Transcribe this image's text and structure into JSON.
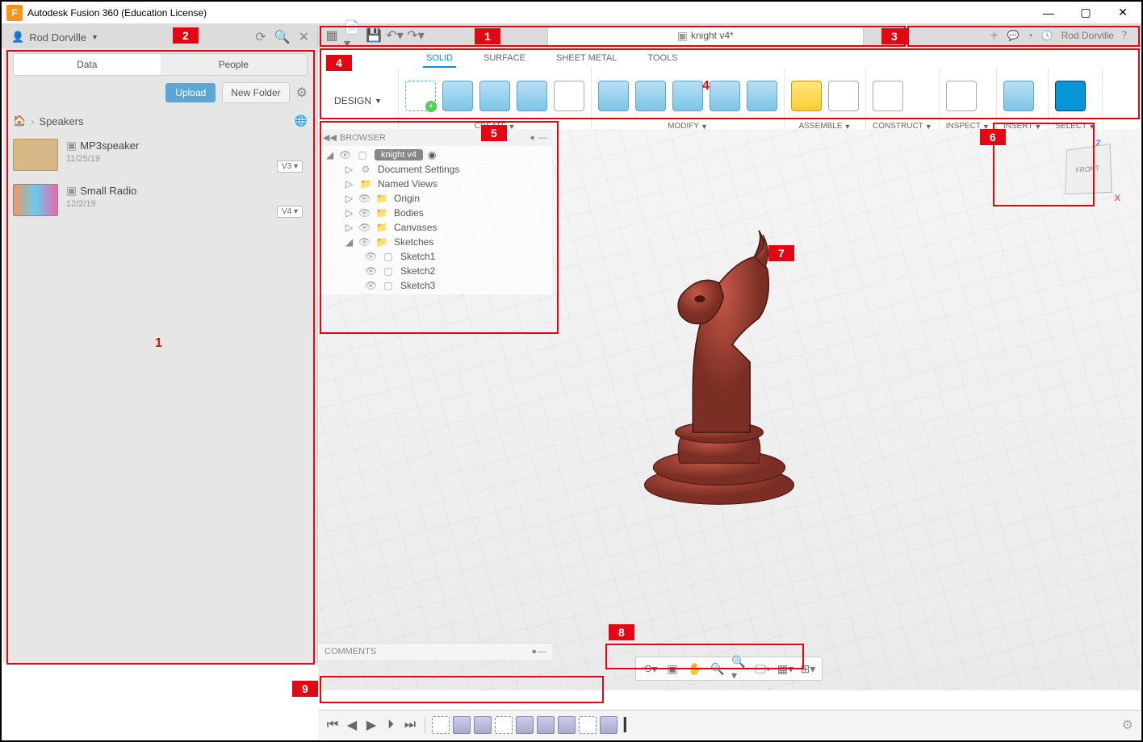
{
  "titlebar": {
    "app_title": "Autodesk Fusion 360 (Education License)"
  },
  "data_panel": {
    "user": "Rod Dorville",
    "tab_data": "Data",
    "tab_people": "People",
    "upload": "Upload",
    "new_folder": "New Folder",
    "breadcrumb": "Speakers",
    "files": [
      {
        "name": "MP3speaker",
        "date": "11/25/19",
        "version": "V3 ▾"
      },
      {
        "name": "Small Radio",
        "date": "12/2/19",
        "version": "V4 ▾"
      }
    ]
  },
  "appbar": {
    "doc_title": "knight v4*",
    "user": "Rod Dorville"
  },
  "ribbon": {
    "workspace": "DESIGN",
    "tabs": [
      "SOLID",
      "SURFACE",
      "SHEET METAL",
      "TOOLS"
    ],
    "groups": {
      "create": "CREATE",
      "modify": "MODIFY",
      "assemble": "ASSEMBLE",
      "construct": "CONSTRUCT",
      "inspect": "INSPECT",
      "insert": "INSERT",
      "select": "SELECT"
    }
  },
  "browser": {
    "title": "BROWSER",
    "root": "knight v4",
    "items": [
      "Document Settings",
      "Named Views",
      "Origin",
      "Bodies",
      "Canvases",
      "Sketches"
    ],
    "sketches": [
      "Sketch1",
      "Sketch2",
      "Sketch3"
    ]
  },
  "viewcube": {
    "face": "FRONT",
    "z": "Z",
    "x": "X"
  },
  "comments": {
    "label": "COMMENTS"
  },
  "callouts": {
    "c1": "1",
    "c2": "2",
    "c3": "3",
    "c4": "4",
    "c5": "5",
    "c6": "6",
    "c7": "7",
    "c8": "8",
    "c9": "9",
    "red1": "1",
    "red4": "4"
  }
}
